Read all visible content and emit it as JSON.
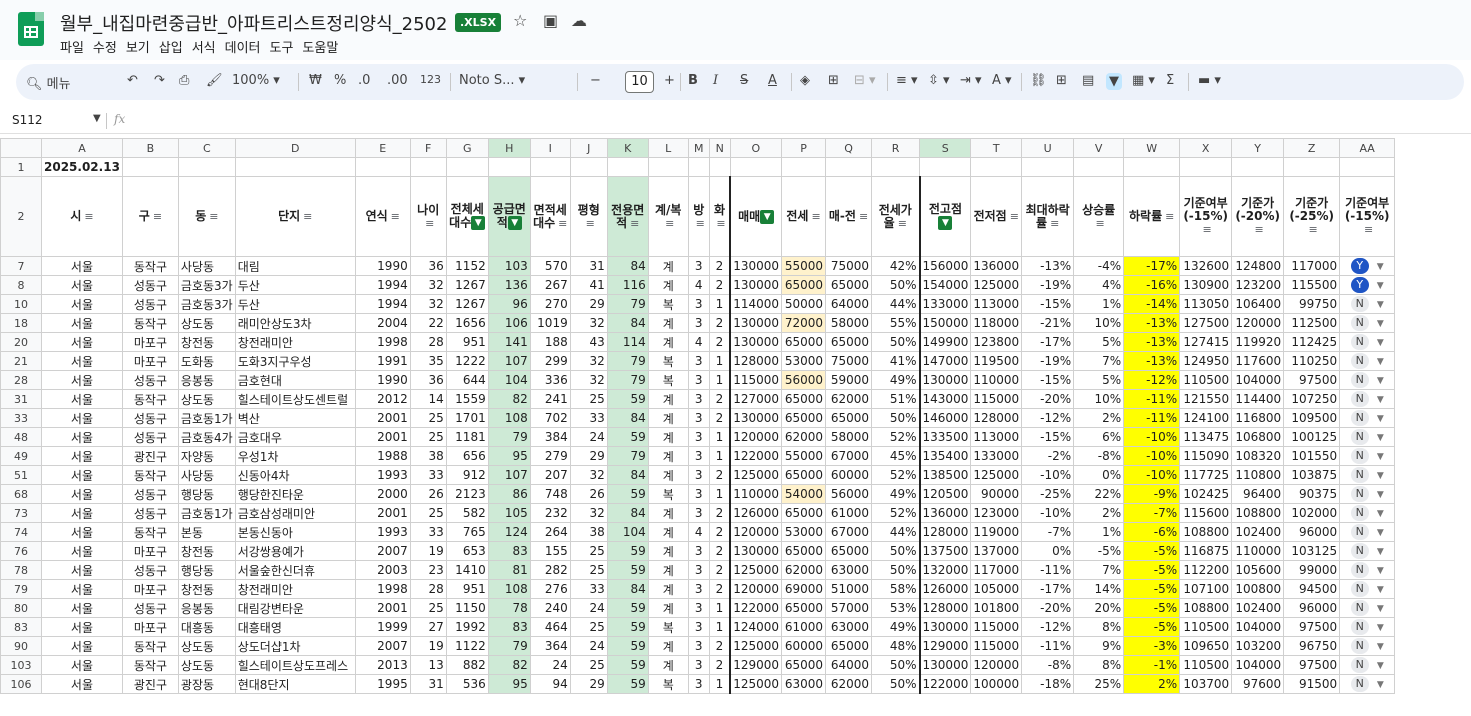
{
  "doc": {
    "title": "월부_내집마련중급반_아파트리스트정리양식_2502",
    "badge": ".XLSX",
    "menu": [
      "파일",
      "수정",
      "보기",
      "삽입",
      "서식",
      "데이터",
      "도구",
      "도움말"
    ]
  },
  "toolbar": {
    "search": "메뉴",
    "zoom": "100%",
    "currency": "₩",
    "percent": "%",
    "dec_less": ".0",
    "dec_more": ".00",
    "number_fmt": "123",
    "font": "Noto S...",
    "font_size": "10",
    "bold": "B",
    "italic": "I",
    "strike": "S",
    "textcolor": "A",
    "sum": "Σ"
  },
  "formula": {
    "name_box": "S112",
    "fx": "fx"
  },
  "columns": [
    "A",
    "B",
    "C",
    "D",
    "E",
    "F",
    "G",
    "H",
    "I",
    "J",
    "K",
    "L",
    "M",
    "N",
    "O",
    "P",
    "Q",
    "R",
    "S",
    "T",
    "U",
    "V",
    "W",
    "X",
    "Y",
    "Z",
    "AA"
  ],
  "date_row": {
    "row_num": "1",
    "date": "2025.02.13"
  },
  "header_row_num": "2",
  "headers": [
    "시",
    "구",
    "동",
    "단지",
    "연식",
    "나이",
    "전체세대수",
    "공급면적",
    "면적세대수",
    "평형",
    "전용면적",
    "계/복",
    "방",
    "화",
    "매매",
    "전세",
    "매-전",
    "전세가율",
    "전고점",
    "전저점",
    "최대하락률",
    "상승률",
    "하락률",
    "기준여부(-15%)",
    "기준가(-20%)",
    "기준가(-25%)",
    "기준여부(-15%)"
  ],
  "rows": [
    {
      "n": "7",
      "c": [
        "서울",
        "동작구",
        "사당동",
        "대림",
        "1990",
        "36",
        "1152",
        "103",
        "570",
        "31",
        "84",
        "계",
        "3",
        "2",
        "130000",
        "55000",
        "75000",
        "42%",
        "156000",
        "136000",
        "-13%",
        "-4%",
        "-17%",
        "132600",
        "124800",
        "117000",
        "Y"
      ]
    },
    {
      "n": "8",
      "c": [
        "서울",
        "성동구",
        "금호동3가",
        "두산",
        "1994",
        "32",
        "1267",
        "136",
        "267",
        "41",
        "116",
        "계",
        "4",
        "2",
        "130000",
        "65000",
        "65000",
        "50%",
        "154000",
        "125000",
        "-19%",
        "4%",
        "-16%",
        "130900",
        "123200",
        "115500",
        "Y"
      ]
    },
    {
      "n": "10",
      "c": [
        "서울",
        "성동구",
        "금호동3가",
        "두산",
        "1994",
        "32",
        "1267",
        "96",
        "270",
        "29",
        "79",
        "복",
        "3",
        "1",
        "114000",
        "50000",
        "64000",
        "44%",
        "133000",
        "113000",
        "-15%",
        "1%",
        "-14%",
        "113050",
        "106400",
        "99750",
        "N"
      ]
    },
    {
      "n": "18",
      "c": [
        "서울",
        "동작구",
        "상도동",
        "래미안상도3차",
        "2004",
        "22",
        "1656",
        "106",
        "1019",
        "32",
        "84",
        "계",
        "3",
        "2",
        "130000",
        "72000",
        "58000",
        "55%",
        "150000",
        "118000",
        "-21%",
        "10%",
        "-13%",
        "127500",
        "120000",
        "112500",
        "N"
      ]
    },
    {
      "n": "20",
      "c": [
        "서울",
        "마포구",
        "창전동",
        "창전래미안",
        "1998",
        "28",
        "951",
        "141",
        "188",
        "43",
        "114",
        "계",
        "4",
        "2",
        "130000",
        "65000",
        "65000",
        "50%",
        "149900",
        "123800",
        "-17%",
        "5%",
        "-13%",
        "127415",
        "119920",
        "112425",
        "N"
      ]
    },
    {
      "n": "21",
      "c": [
        "서울",
        "마포구",
        "도화동",
        "도화3지구우성",
        "1991",
        "35",
        "1222",
        "107",
        "299",
        "32",
        "79",
        "복",
        "3",
        "1",
        "128000",
        "53000",
        "75000",
        "41%",
        "147000",
        "119500",
        "-19%",
        "7%",
        "-13%",
        "124950",
        "117600",
        "110250",
        "N"
      ]
    },
    {
      "n": "28",
      "c": [
        "서울",
        "성동구",
        "응봉동",
        "금호현대",
        "1990",
        "36",
        "644",
        "104",
        "336",
        "32",
        "79",
        "복",
        "3",
        "1",
        "115000",
        "56000",
        "59000",
        "49%",
        "130000",
        "110000",
        "-15%",
        "5%",
        "-12%",
        "110500",
        "104000",
        "97500",
        "N"
      ]
    },
    {
      "n": "31",
      "c": [
        "서울",
        "동작구",
        "상도동",
        "힐스테이트상도센트럴",
        "2012",
        "14",
        "1559",
        "82",
        "241",
        "25",
        "59",
        "계",
        "3",
        "2",
        "127000",
        "65000",
        "62000",
        "51%",
        "143000",
        "115000",
        "-20%",
        "10%",
        "-11%",
        "121550",
        "114400",
        "107250",
        "N"
      ]
    },
    {
      "n": "33",
      "c": [
        "서울",
        "성동구",
        "금호동1가",
        "벽산",
        "2001",
        "25",
        "1701",
        "108",
        "702",
        "33",
        "84",
        "계",
        "3",
        "2",
        "130000",
        "65000",
        "65000",
        "50%",
        "146000",
        "128000",
        "-12%",
        "2%",
        "-11%",
        "124100",
        "116800",
        "109500",
        "N"
      ]
    },
    {
      "n": "48",
      "c": [
        "서울",
        "성동구",
        "금호동4가",
        "금호대우",
        "2001",
        "25",
        "1181",
        "79",
        "384",
        "24",
        "59",
        "계",
        "3",
        "1",
        "120000",
        "62000",
        "58000",
        "52%",
        "133500",
        "113000",
        "-15%",
        "6%",
        "-10%",
        "113475",
        "106800",
        "100125",
        "N"
      ]
    },
    {
      "n": "49",
      "c": [
        "서울",
        "광진구",
        "자양동",
        "우성1차",
        "1988",
        "38",
        "656",
        "95",
        "279",
        "29",
        "79",
        "계",
        "3",
        "1",
        "122000",
        "55000",
        "67000",
        "45%",
        "135400",
        "133000",
        "-2%",
        "-8%",
        "-10%",
        "115090",
        "108320",
        "101550",
        "N"
      ]
    },
    {
      "n": "51",
      "c": [
        "서울",
        "동작구",
        "사당동",
        "신동아4차",
        "1993",
        "33",
        "912",
        "107",
        "207",
        "32",
        "84",
        "계",
        "3",
        "2",
        "125000",
        "65000",
        "60000",
        "52%",
        "138500",
        "125000",
        "-10%",
        "0%",
        "-10%",
        "117725",
        "110800",
        "103875",
        "N"
      ]
    },
    {
      "n": "68",
      "c": [
        "서울",
        "성동구",
        "행당동",
        "행당한진타운",
        "2000",
        "26",
        "2123",
        "86",
        "748",
        "26",
        "59",
        "복",
        "3",
        "1",
        "110000",
        "54000",
        "56000",
        "49%",
        "120500",
        "90000",
        "-25%",
        "22%",
        "-9%",
        "102425",
        "96400",
        "90375",
        "N"
      ]
    },
    {
      "n": "73",
      "c": [
        "서울",
        "성동구",
        "금호동1가",
        "금호삼성래미안",
        "2001",
        "25",
        "582",
        "105",
        "232",
        "32",
        "84",
        "계",
        "3",
        "2",
        "126000",
        "65000",
        "61000",
        "52%",
        "136000",
        "123000",
        "-10%",
        "2%",
        "-7%",
        "115600",
        "108800",
        "102000",
        "N"
      ]
    },
    {
      "n": "74",
      "c": [
        "서울",
        "동작구",
        "본동",
        "본동신동아",
        "1993",
        "33",
        "765",
        "124",
        "264",
        "38",
        "104",
        "계",
        "4",
        "2",
        "120000",
        "53000",
        "67000",
        "44%",
        "128000",
        "119000",
        "-7%",
        "1%",
        "-6%",
        "108800",
        "102400",
        "96000",
        "N"
      ]
    },
    {
      "n": "76",
      "c": [
        "서울",
        "마포구",
        "창전동",
        "서강쌍용예가",
        "2007",
        "19",
        "653",
        "83",
        "155",
        "25",
        "59",
        "계",
        "3",
        "2",
        "130000",
        "65000",
        "65000",
        "50%",
        "137500",
        "137000",
        "0%",
        "-5%",
        "-5%",
        "116875",
        "110000",
        "103125",
        "N"
      ]
    },
    {
      "n": "78",
      "c": [
        "서울",
        "성동구",
        "행당동",
        "서울숲한신더휴",
        "2003",
        "23",
        "1410",
        "81",
        "282",
        "25",
        "59",
        "계",
        "3",
        "2",
        "125000",
        "62000",
        "63000",
        "50%",
        "132000",
        "117000",
        "-11%",
        "7%",
        "-5%",
        "112200",
        "105600",
        "99000",
        "N"
      ]
    },
    {
      "n": "79",
      "c": [
        "서울",
        "마포구",
        "창전동",
        "창전래미안",
        "1998",
        "28",
        "951",
        "108",
        "276",
        "33",
        "84",
        "계",
        "3",
        "2",
        "120000",
        "69000",
        "51000",
        "58%",
        "126000",
        "105000",
        "-17%",
        "14%",
        "-5%",
        "107100",
        "100800",
        "94500",
        "N"
      ]
    },
    {
      "n": "80",
      "c": [
        "서울",
        "성동구",
        "응봉동",
        "대림강변타운",
        "2001",
        "25",
        "1150",
        "78",
        "240",
        "24",
        "59",
        "계",
        "3",
        "1",
        "122000",
        "65000",
        "57000",
        "53%",
        "128000",
        "101800",
        "-20%",
        "20%",
        "-5%",
        "108800",
        "102400",
        "96000",
        "N"
      ]
    },
    {
      "n": "83",
      "c": [
        "서울",
        "마포구",
        "대흥동",
        "대흥태영",
        "1999",
        "27",
        "1992",
        "83",
        "464",
        "25",
        "59",
        "복",
        "3",
        "1",
        "124000",
        "61000",
        "63000",
        "49%",
        "130000",
        "115000",
        "-12%",
        "8%",
        "-5%",
        "110500",
        "104000",
        "97500",
        "N"
      ]
    },
    {
      "n": "90",
      "c": [
        "서울",
        "동작구",
        "상도동",
        "상도더샵1차",
        "2007",
        "19",
        "1122",
        "79",
        "364",
        "24",
        "59",
        "계",
        "3",
        "2",
        "125000",
        "60000",
        "65000",
        "48%",
        "129000",
        "115000",
        "-11%",
        "9%",
        "-3%",
        "109650",
        "103200",
        "96750",
        "N"
      ]
    },
    {
      "n": "103",
      "c": [
        "서울",
        "동작구",
        "상도동",
        "힐스테이트상도프레스",
        "2013",
        "13",
        "882",
        "82",
        "24",
        "25",
        "59",
        "계",
        "3",
        "2",
        "129000",
        "65000",
        "64000",
        "50%",
        "130000",
        "120000",
        "-8%",
        "8%",
        "-1%",
        "110500",
        "104000",
        "97500",
        "N"
      ]
    },
    {
      "n": "106",
      "c": [
        "서울",
        "광진구",
        "광장동",
        "현대8단지",
        "1995",
        "31",
        "536",
        "95",
        "94",
        "29",
        "59",
        "복",
        "3",
        "1",
        "125000",
        "63000",
        "62000",
        "50%",
        "122000",
        "100000",
        "-18%",
        "25%",
        "2%",
        "103700",
        "97600",
        "91500",
        "N"
      ]
    }
  ],
  "highlights": {
    "orange_cells": [
      [
        1,
        15
      ],
      [
        2,
        15
      ],
      [
        4,
        15
      ],
      [
        7,
        15
      ],
      [
        13,
        15
      ]
    ],
    "green_cols": [
      7,
      10
    ],
    "yellow_col": 22,
    "filter_on_cols": [
      6,
      7,
      14,
      18
    ]
  }
}
